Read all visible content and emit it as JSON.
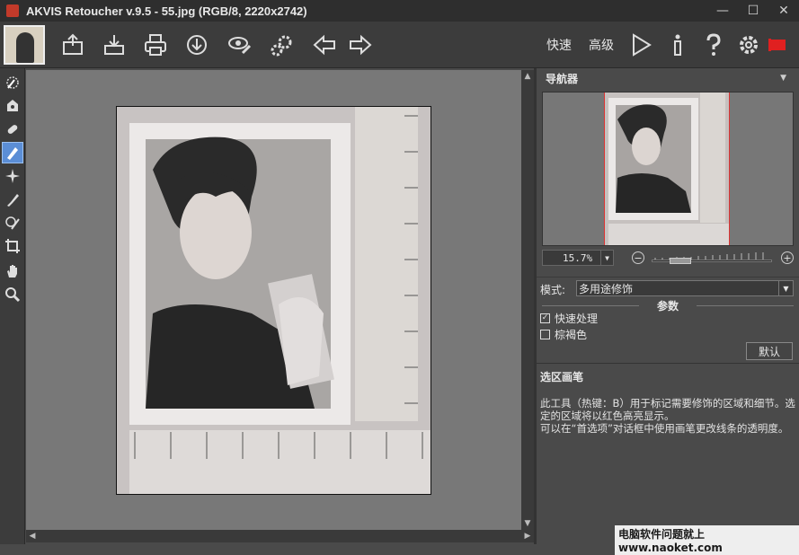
{
  "window": {
    "title": "AKVIS Retoucher v.9.5 - 55.jpg (RGB/8, 2220x2742)",
    "controls": [
      "—",
      "☐",
      "✕"
    ]
  },
  "toolbar": {
    "buttons": [
      "open-icon",
      "save-icon",
      "print-icon",
      "share-icon",
      "preview-icon",
      "settings-icon",
      "undo-icon",
      "redo-icon"
    ],
    "fast_label": "快速",
    "advanced_label": "高级",
    "run_icon": "play-icon",
    "info_icon": "info-icon",
    "help_icon": "help-icon",
    "preferences_icon": "gear-icon",
    "notify_icon": "red-flag-icon"
  },
  "tools": [
    "brush-icon",
    "stamp-icon",
    "patch-icon",
    "selection-brush-icon",
    "magic-icon",
    "eraser-icon",
    "clone-icon",
    "crop-icon",
    "hand-icon",
    "zoom-icon"
  ],
  "active_tool_index": 3,
  "navigator": {
    "title": "导航器",
    "zoom_value": "15.7%"
  },
  "settings": {
    "mode_label": "模式:",
    "mode_value": "多用途修饰",
    "params_title": "参数",
    "quick_process_label": "快速处理",
    "quick_process_checked": true,
    "sepia_label": "棕褐色",
    "sepia_checked": false,
    "default_button": "默认"
  },
  "help": {
    "title": "选区画笔",
    "line1": "此工具（热键：B）用于标记需要修饰的区域和细节。选定的区域将以红色高亮显示。",
    "line2": "可以在“首选项”对话框中使用画笔更改线条的透明度。"
  },
  "watermark": "电脑软件问题就上www.naoket.com",
  "colors": {
    "accent": "#5b8ed6",
    "notify": "#e02020",
    "selection": "#dd3333"
  }
}
